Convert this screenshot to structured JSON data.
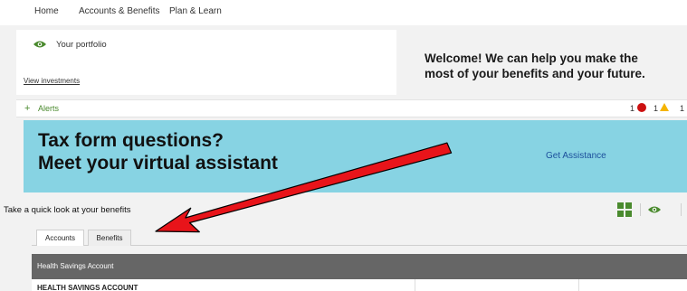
{
  "nav": {
    "items": [
      "Home",
      "Accounts & Benefits",
      "Plan & Learn"
    ]
  },
  "portfolio": {
    "title": "Your portfolio",
    "view_link": "View investments",
    "icon": "eye-icon"
  },
  "welcome": {
    "line1": "Welcome! We can help you make the",
    "line2": "most of your benefits and your future."
  },
  "alerts": {
    "label": "Alerts",
    "red_count": "1",
    "warn_count": "1",
    "third_count": "1"
  },
  "banner": {
    "line1": "Tax form questions?",
    "line2": "Meet your virtual assistant",
    "cta": "Get Assistance",
    "bg_color": "#87d3e3"
  },
  "benefits": {
    "title": "Take a quick look at your benefits",
    "tabs": [
      "Accounts",
      "Benefits"
    ],
    "section_header": "Health Savings Account",
    "row_label": "HEALTH SAVINGS ACCOUNT"
  },
  "colors": {
    "accent_green": "#4a8a2e",
    "alert_red": "#cc1111",
    "alert_yellow": "#f5b400",
    "annotation_arrow": "#e8141a",
    "header_gray": "#666666"
  }
}
